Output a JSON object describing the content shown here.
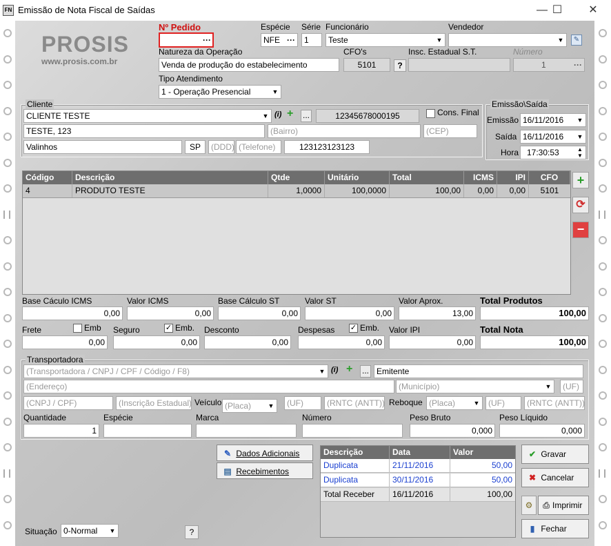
{
  "window": {
    "title": "Emissão de Nota Fiscal de Saídas",
    "icon": "FN",
    "minimize": "—",
    "maximize": "☐",
    "close": "✕"
  },
  "logo": {
    "name": "PROSIS",
    "url": "www.prosis.com.br"
  },
  "header": {
    "pedido_label": "Nº Pedido",
    "pedido_value": "",
    "especie_label": "Espécie",
    "especie_value": "NFE",
    "serie_label": "Série",
    "serie_value": "1",
    "funcionario_label": "Funcionário",
    "funcionario_value": "Teste",
    "vendedor_label": "Vendedor",
    "vendedor_value": "",
    "natureza_label": "Natureza da Operação",
    "natureza_value": "Venda de produção do estabelecimento",
    "cfo_label": "CFO's",
    "cfo_value": "5101",
    "cfo_help": "?",
    "insc_label": "Insc. Estadual S.T.",
    "insc_value": "",
    "numero_label": "Número",
    "numero_value": "1",
    "tipo_label": "Tipo Atendimento",
    "tipo_value": "1 - Operação Presencial",
    "ellipsis": "···"
  },
  "cliente": {
    "group": "Cliente",
    "name": "CLIENTE TESTE",
    "info": "(i)",
    "add": "+",
    "more": "...",
    "doc": "12345678000195",
    "cons_final": "Cons. Final",
    "address": "TESTE, 123",
    "bairro_ph": "(Bairro)",
    "cep_ph": "(CEP)",
    "city": "Valinhos",
    "uf": "SP",
    "ddd_ph": "(DDD)",
    "tel_ph": "(Telefone)",
    "ie": "123123123123"
  },
  "emissao": {
    "group": "Emissão\\Saída",
    "emissao_label": "Emissão",
    "emissao_value": "16/11/2016",
    "saida_label": "Saída",
    "saida_value": "16/11/2016",
    "hora_label": "Hora",
    "hora_value": "17:30:53"
  },
  "items": {
    "columns": [
      "Código",
      "Descrição",
      "Qtde",
      "Unitário",
      "Total",
      "ICMS",
      "IPI",
      "CFO"
    ],
    "rows": [
      [
        "4",
        "PRODUTO TESTE",
        "1,0000",
        "100,0000",
        "100,00",
        "0,00",
        "0,00",
        "5101"
      ]
    ]
  },
  "totais": {
    "base_icms_label": "Base Cáculo ICMS",
    "base_icms": "0,00",
    "valor_icms_label": "Valor ICMS",
    "valor_icms": "0,00",
    "base_st_label": "Base Cálculo ST",
    "base_st": "0,00",
    "valor_st_label": "Valor ST",
    "valor_st": "0,00",
    "valor_aprox_label": "Valor Aprox.",
    "valor_aprox": "13,00",
    "total_produtos_label": "Total Produtos",
    "total_produtos": "100,00",
    "frete_label": "Frete",
    "frete": "0,00",
    "emb1": "Emb",
    "seguro_label": "Seguro",
    "seguro": "0,00",
    "emb2": "Emb.",
    "desconto_label": "Desconto",
    "desconto": "0,00",
    "despesas_label": "Despesas",
    "despesas": "0,00",
    "emb3": "Emb.",
    "ipi_label": "Valor IPI",
    "ipi": "0,00",
    "total_nota_label": "Total Nota",
    "total_nota": "100,00"
  },
  "transp": {
    "group": "Transportadora",
    "ph": "(Transportadora / CNPJ / CPF / Código / F8)",
    "emitente": "Emitente",
    "endereco_ph": "(Endereço)",
    "municipio_ph": "(Município)",
    "uf_ph": "(UF)",
    "cnpj_ph": "(CNPJ / CPF)",
    "insc_ph": "(Inscrição Estadual)",
    "veiculo_label": "Veículo",
    "placa_ph": "(Placa)",
    "rntc_ph": "(RNTC (ANTT))",
    "reboque_label": "Reboque",
    "quantidade_label": "Quantidade",
    "quantidade": "1",
    "especie_label": "Espécie",
    "marca_label": "Marca",
    "numero_label": "Número",
    "peso_bruto_label": "Peso Bruto",
    "peso_bruto": "0,000",
    "peso_liq_label": "Peso Líquido",
    "peso_liq": "0,000"
  },
  "buttons": {
    "dados": "Dados Adicionais",
    "receb": "Recebimentos",
    "gravar": "Gravar",
    "cancelar": "Cancelar",
    "imprimir": "Imprimir",
    "fechar": "Fechar",
    "help": "?"
  },
  "parcelas": {
    "columns": [
      "Descrição",
      "Data",
      "Valor"
    ],
    "rows": [
      [
        "Duplicata",
        "21/11/2016",
        "50,00"
      ],
      [
        "Duplicata",
        "30/11/2016",
        "50,00"
      ],
      [
        "Total Receber",
        "16/11/2016",
        "100,00"
      ]
    ]
  },
  "situacao": {
    "label": "Situação",
    "value": "0-Normal"
  },
  "colors": {
    "pedido_border": "#e02020",
    "pedido_label": "#d01010",
    "header_bg": "#6e6e6e",
    "link": "#1a3fd0"
  }
}
